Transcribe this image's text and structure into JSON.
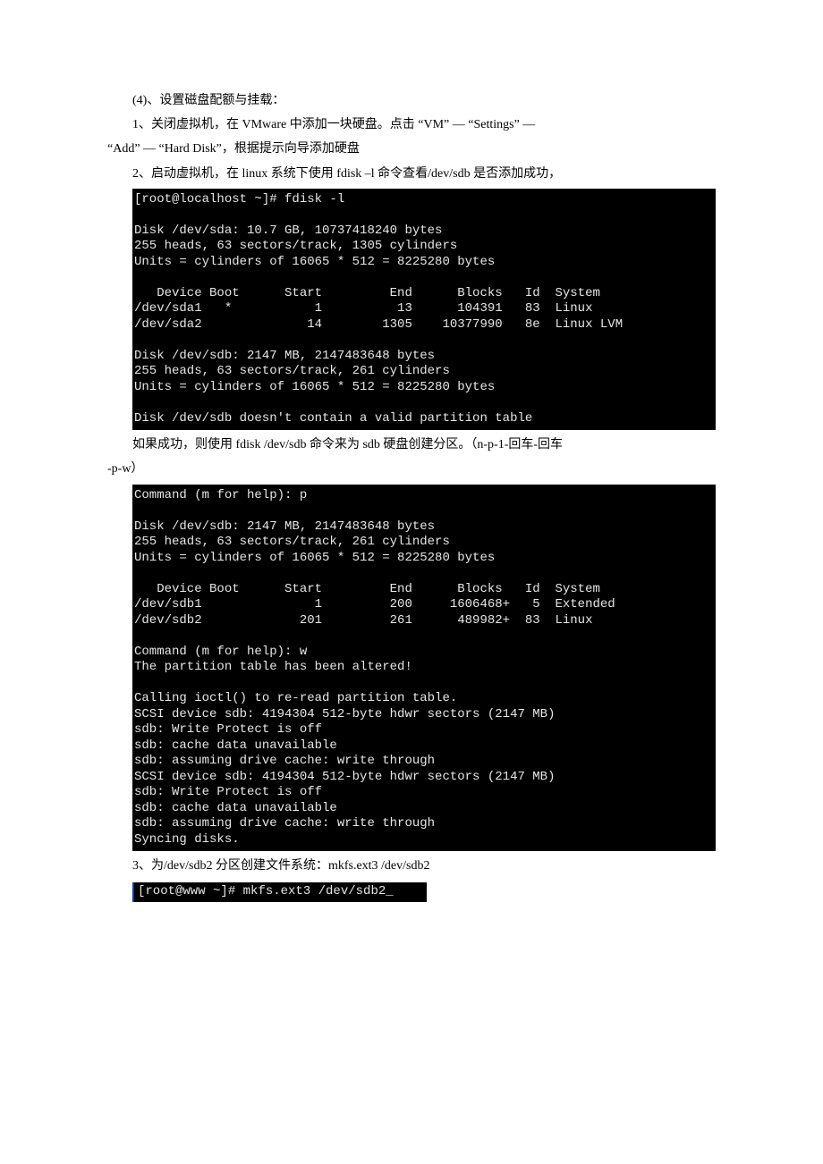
{
  "text": {
    "p1": "(4)、设置磁盘配额与挂载：",
    "p2": "1、关闭虚拟机，在 VMware 中添加一块硬盘。点击 “VM” — “Settings” —",
    "p3": "“Add” — “Hard Disk”，根据提示向导添加硬盘",
    "p4": "2、启动虚拟机，在 linux 系统下使用 fdisk –l 命令查看/dev/sdb 是否添加成功，",
    "p5": "如果成功，则使用 fdisk /dev/sdb  命令来为 sdb 硬盘创建分区。（n-p-1-回车-回车",
    "p6": "-p-w）",
    "p7": "3、为/dev/sdb2 分区创建文件系统：mkfs.ext3 /dev/sdb2"
  },
  "term1": "[root@localhost ~]# fdisk -l\n\nDisk /dev/sda: 10.7 GB, 10737418240 bytes\n255 heads, 63 sectors/track, 1305 cylinders\nUnits = cylinders of 16065 * 512 = 8225280 bytes\n\n   Device Boot      Start         End      Blocks   Id  System\n/dev/sda1   *           1          13      104391   83  Linux\n/dev/sda2              14        1305    10377990   8e  Linux LVM\n\nDisk /dev/sdb: 2147 MB, 2147483648 bytes\n255 heads, 63 sectors/track, 261 cylinders\nUnits = cylinders of 16065 * 512 = 8225280 bytes\n\nDisk /dev/sdb doesn't contain a valid partition table",
  "term2": "Command (m for help): p\n\nDisk /dev/sdb: 2147 MB, 2147483648 bytes\n255 heads, 63 sectors/track, 261 cylinders\nUnits = cylinders of 16065 * 512 = 8225280 bytes\n\n   Device Boot      Start         End      Blocks   Id  System\n/dev/sdb1               1         200     1606468+   5  Extended\n/dev/sdb2             201         261      489982+  83  Linux\n\nCommand (m for help): w\nThe partition table has been altered!\n\nCalling ioctl() to re-read partition table.\nSCSI device sdb: 4194304 512-byte hdwr sectors (2147 MB)\nsdb: Write Protect is off\nsdb: cache data unavailable\nsdb: assuming drive cache: write through\nSCSI device sdb: 4194304 512-byte hdwr sectors (2147 MB)\nsdb: Write Protect is off\nsdb: cache data unavailable\nsdb: assuming drive cache: write through\nSyncing disks.",
  "term3": "[root@www ~]# mkfs.ext3 /dev/sdb2_    "
}
